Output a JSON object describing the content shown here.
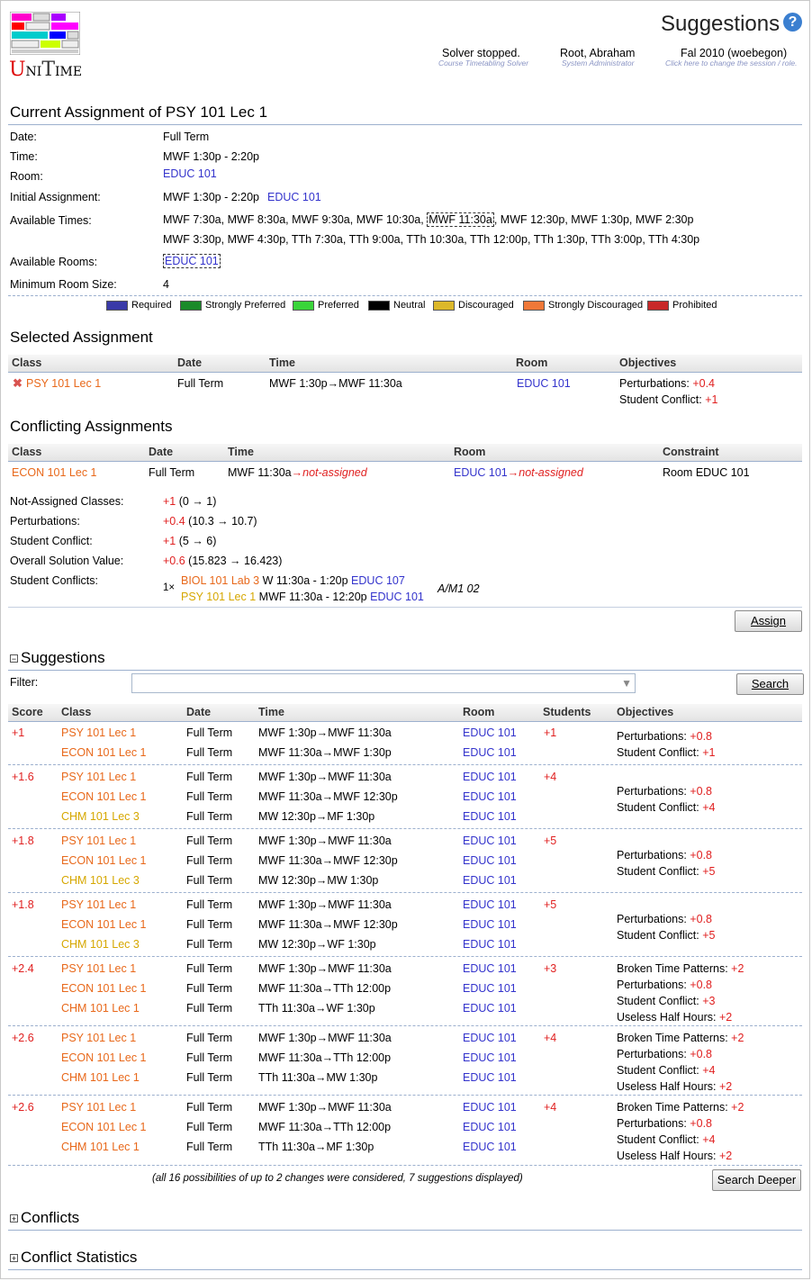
{
  "header": {
    "page_title": "Suggestions",
    "help_icon": "question-circle-icon",
    "logo_text": "UniTime",
    "solver_status": "Solver stopped.",
    "solver_sub": "Course Timetabling Solver",
    "user_name": "Root, Abraham",
    "user_role": "System Administrator",
    "session": "Fal 2010 (woebegon)",
    "session_sub": "Click here to change the session / role."
  },
  "current": {
    "title": "Current Assignment of PSY 101 Lec 1",
    "date_label": "Date:",
    "date": "Full Term",
    "time_label": "Time:",
    "time": "MWF 1:30p - 2:20p",
    "room_label": "Room:",
    "room": "EDUC 101",
    "initial_label": "Initial Assignment:",
    "initial_time": "MWF 1:30p - 2:20p",
    "initial_room": "EDUC 101",
    "avail_times_label": "Available Times:",
    "avail_times_row1": [
      "MWF 7:30a",
      "MWF 8:30a",
      "MWF 9:30a",
      "MWF 10:30a",
      "MWF 11:30a",
      "MWF 12:30p",
      "MWF 1:30p",
      "MWF 2:30p"
    ],
    "avail_times_row2": [
      "MWF 3:30p",
      "MWF 4:30p",
      "TTh 7:30a",
      "TTh 9:00a",
      "TTh 10:30a",
      "TTh 12:00p",
      "TTh 1:30p",
      "TTh 3:00p",
      "TTh 4:30p"
    ],
    "avail_rooms_label": "Available Rooms:",
    "avail_room": "EDUC 101",
    "min_size_label": "Minimum Room Size:",
    "min_size": "4"
  },
  "legend": [
    {
      "label": "Required",
      "color": "#3a3aa8"
    },
    {
      "label": "Strongly Preferred",
      "color": "#1a8a2a"
    },
    {
      "label": "Preferred",
      "color": "#3ad43a"
    },
    {
      "label": "Neutral",
      "color": "#000000"
    },
    {
      "label": "Discouraged",
      "color": "#dcb82a"
    },
    {
      "label": "Strongly Discouraged",
      "color": "#f07838"
    },
    {
      "label": "Prohibited",
      "color": "#c82828"
    }
  ],
  "selected": {
    "title": "Selected Assignment",
    "headers": [
      "Class",
      "Date",
      "Time",
      "Room",
      "Objectives"
    ],
    "class": "PSY 101 Lec 1",
    "date": "Full Term",
    "time": "MWF 1:30p→MWF 11:30a",
    "room": "EDUC 101",
    "obj1_label": "Perturbations:",
    "obj1_value": "+0.4",
    "obj2_label": "Student Conflict:",
    "obj2_value": "+1"
  },
  "conflicting": {
    "title": "Conflicting Assignments",
    "headers": [
      "Class",
      "Date",
      "Time",
      "Room",
      "Constraint"
    ],
    "class": "ECON 101 Lec 1",
    "date": "Full Term",
    "time": "MWF 11:30a",
    "time_na": "→not-assigned",
    "room": "EDUC 101",
    "room_na": "→not-assigned",
    "constraint": "Room EDUC 101"
  },
  "summary": {
    "nac_label": "Not-Assigned Classes:",
    "nac_value": "+1",
    "nac_detail": " (0 → 1)",
    "pert_label": "Perturbations:",
    "pert_value": "+0.4",
    "pert_detail": " (10.3 → 10.7)",
    "sc_label": "Student Conflict:",
    "sc_value": "+1",
    "sc_detail": " (5 → 6)",
    "osv_label": "Overall Solution Value:",
    "osv_value": "+0.6",
    "osv_detail": " (15.823 → 16.423)",
    "stc_label": "Student Conflicts:",
    "stc_count": "1×",
    "stc1_class": "BIOL 101 Lab 3",
    "stc1_time": "W 11:30a - 1:20p",
    "stc1_room": "EDUC 107",
    "stc2_class": "PSY 101 Lec 1",
    "stc2_time": "MWF 11:30a - 12:20p",
    "stc2_room": "EDUC 101",
    "stc_tag": "A/M1 02",
    "assign_button": "Assign"
  },
  "suggestions": {
    "title": "Suggestions",
    "filter_label": "Filter:",
    "search_button": "Search",
    "headers": [
      "Score",
      "Class",
      "Date",
      "Time",
      "Room",
      "Students",
      "Objectives"
    ],
    "footer": "(all 16 possibilities of up to 2 changes were considered, 7 suggestions displayed)",
    "search_deeper_button": "Search Deeper",
    "rows": [
      {
        "score": "+1",
        "students": "+1",
        "lines": [
          {
            "cls": "PSY 101 Lec 1",
            "color": "orange",
            "date": "Full Term",
            "time": "MWF 1:30p→MWF 11:30a",
            "room": "EDUC 101"
          },
          {
            "cls": "ECON 101 Lec 1",
            "color": "orange",
            "date": "Full Term",
            "time": "MWF 11:30a→MWF 1:30p",
            "room": "EDUC 101"
          }
        ],
        "obj": [
          {
            "l": "Perturbations:",
            "v": "+0.8"
          },
          {
            "l": "Student Conflict:",
            "v": "+1"
          }
        ]
      },
      {
        "score": "+1.6",
        "students": "+4",
        "lines": [
          {
            "cls": "PSY 101 Lec 1",
            "color": "orange",
            "date": "Full Term",
            "time": "MWF 1:30p→MWF 11:30a",
            "room": "EDUC 101"
          },
          {
            "cls": "ECON 101 Lec 1",
            "color": "orange",
            "date": "Full Term",
            "time": "MWF 11:30a→MWF 12:30p",
            "room": "EDUC 101"
          },
          {
            "cls": "CHM 101 Lec 3",
            "color": "yellow",
            "date": "Full Term",
            "time": "MW 12:30p→MF 1:30p",
            "room": "EDUC 101"
          }
        ],
        "obj": [
          {
            "l": "Perturbations:",
            "v": "+0.8"
          },
          {
            "l": "Student Conflict:",
            "v": "+4"
          }
        ]
      },
      {
        "score": "+1.8",
        "students": "+5",
        "lines": [
          {
            "cls": "PSY 101 Lec 1",
            "color": "orange",
            "date": "Full Term",
            "time": "MWF 1:30p→MWF 11:30a",
            "room": "EDUC 101"
          },
          {
            "cls": "ECON 101 Lec 1",
            "color": "orange",
            "date": "Full Term",
            "time": "MWF 11:30a→MWF 12:30p",
            "room": "EDUC 101"
          },
          {
            "cls": "CHM 101 Lec 3",
            "color": "yellow",
            "date": "Full Term",
            "time": "MW 12:30p→MW 1:30p",
            "room": "EDUC 101"
          }
        ],
        "obj": [
          {
            "l": "Perturbations:",
            "v": "+0.8"
          },
          {
            "l": "Student Conflict:",
            "v": "+5"
          }
        ]
      },
      {
        "score": "+1.8",
        "students": "+5",
        "lines": [
          {
            "cls": "PSY 101 Lec 1",
            "color": "orange",
            "date": "Full Term",
            "time": "MWF 1:30p→MWF 11:30a",
            "room": "EDUC 101"
          },
          {
            "cls": "ECON 101 Lec 1",
            "color": "orange",
            "date": "Full Term",
            "time": "MWF 11:30a→MWF 12:30p",
            "room": "EDUC 101"
          },
          {
            "cls": "CHM 101 Lec 3",
            "color": "yellow",
            "date": "Full Term",
            "time": "MW 12:30p→WF 1:30p",
            "room": "EDUC 101"
          }
        ],
        "obj": [
          {
            "l": "Perturbations:",
            "v": "+0.8"
          },
          {
            "l": "Student Conflict:",
            "v": "+5"
          }
        ]
      },
      {
        "score": "+2.4",
        "students": "+3",
        "lines": [
          {
            "cls": "PSY 101 Lec 1",
            "color": "orange",
            "date": "Full Term",
            "time": "MWF 1:30p→MWF 11:30a",
            "room": "EDUC 101"
          },
          {
            "cls": "ECON 101 Lec 1",
            "color": "orange",
            "date": "Full Term",
            "time": "MWF 11:30a→TTh 12:00p",
            "room": "EDUC 101"
          },
          {
            "cls": "CHM 101 Lec 1",
            "color": "orange",
            "date": "Full Term",
            "time": "TTh 11:30a→WF 1:30p",
            "room": "EDUC 101"
          }
        ],
        "obj": [
          {
            "l": "Broken Time Patterns:",
            "v": "+2"
          },
          {
            "l": "Perturbations:",
            "v": "+0.8"
          },
          {
            "l": "Student Conflict:",
            "v": "+3"
          },
          {
            "l": "Useless Half Hours:",
            "v": "+2"
          }
        ]
      },
      {
        "score": "+2.6",
        "students": "+4",
        "lines": [
          {
            "cls": "PSY 101 Lec 1",
            "color": "orange",
            "date": "Full Term",
            "time": "MWF 1:30p→MWF 11:30a",
            "room": "EDUC 101"
          },
          {
            "cls": "ECON 101 Lec 1",
            "color": "orange",
            "date": "Full Term",
            "time": "MWF 11:30a→TTh 12:00p",
            "room": "EDUC 101"
          },
          {
            "cls": "CHM 101 Lec 1",
            "color": "orange",
            "date": "Full Term",
            "time": "TTh 11:30a→MW 1:30p",
            "room": "EDUC 101"
          }
        ],
        "obj": [
          {
            "l": "Broken Time Patterns:",
            "v": "+2"
          },
          {
            "l": "Perturbations:",
            "v": "+0.8"
          },
          {
            "l": "Student Conflict:",
            "v": "+4"
          },
          {
            "l": "Useless Half Hours:",
            "v": "+2"
          }
        ]
      },
      {
        "score": "+2.6",
        "students": "+4",
        "lines": [
          {
            "cls": "PSY 101 Lec 1",
            "color": "orange",
            "date": "Full Term",
            "time": "MWF 1:30p→MWF 11:30a",
            "room": "EDUC 101"
          },
          {
            "cls": "ECON 101 Lec 1",
            "color": "orange",
            "date": "Full Term",
            "time": "MWF 11:30a→TTh 12:00p",
            "room": "EDUC 101"
          },
          {
            "cls": "CHM 101 Lec 1",
            "color": "orange",
            "date": "Full Term",
            "time": "TTh 11:30a→MF 1:30p",
            "room": "EDUC 101"
          }
        ],
        "obj": [
          {
            "l": "Broken Time Patterns:",
            "v": "+2"
          },
          {
            "l": "Perturbations:",
            "v": "+0.8"
          },
          {
            "l": "Student Conflict:",
            "v": "+4"
          },
          {
            "l": "Useless Half Hours:",
            "v": "+2"
          }
        ]
      }
    ]
  },
  "collapsed": {
    "conflicts_title": "Conflicts",
    "conflict_stats_title": "Conflict Statistics"
  }
}
